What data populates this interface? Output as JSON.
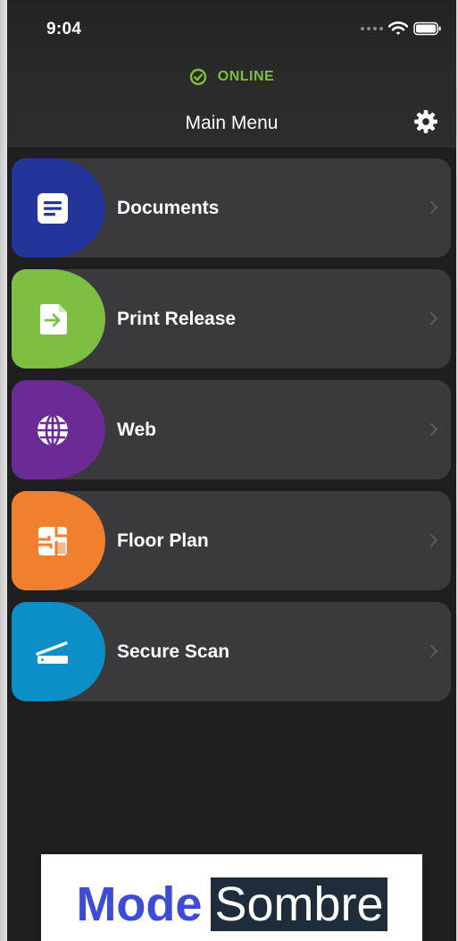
{
  "status_bar": {
    "time": "9:04",
    "icons": [
      "signal-dots-icon",
      "wifi-icon",
      "battery-icon"
    ]
  },
  "connection": {
    "label": "ONLINE",
    "icon": "check-circle-icon",
    "color": "#7cc03d"
  },
  "nav": {
    "title": "Main Menu",
    "settings_icon": "gear-icon"
  },
  "menu": {
    "items": [
      {
        "label": "Documents",
        "icon": "document-icon",
        "color": "#23359b"
      },
      {
        "label": "Print Release",
        "icon": "file-arrow-icon",
        "color": "#7ebf43"
      },
      {
        "label": "Web",
        "icon": "globe-icon",
        "color": "#6b2a95"
      },
      {
        "label": "Floor Plan",
        "icon": "floor-plan-icon",
        "color": "#f07f2e"
      },
      {
        "label": "Secure Scan",
        "icon": "scanner-icon",
        "color": "#0c8fc7"
      }
    ]
  },
  "caption": {
    "word1": "Mode",
    "word2": "Sombre"
  }
}
